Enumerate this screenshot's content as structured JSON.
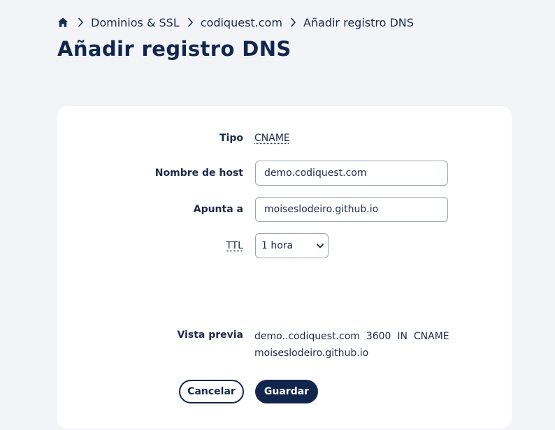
{
  "breadcrumb": {
    "home_icon": "home-icon",
    "separator_icon": "chevron-right-icon",
    "items": [
      "Dominios & SSL",
      "codiquest.com"
    ],
    "current": "Añadir registro DNS"
  },
  "page_title": "Añadir registro DNS",
  "form": {
    "type": {
      "label": "Tipo",
      "value": "CNAME"
    },
    "hostname": {
      "label": "Nombre de host",
      "value": "demo.codiquest.com"
    },
    "points_to": {
      "label": "Apunta a",
      "value": "moiseslodeiro.github.io"
    },
    "ttl": {
      "label": "TTL",
      "selected": "1 hora"
    },
    "preview": {
      "label": "Vista previa",
      "host": "demo..codiquest.com",
      "ttl": "3600",
      "class": "IN",
      "type": "CNAME",
      "target": "moiseslodeiro.github.io"
    },
    "cancel_label": "Cancelar",
    "save_label": "Guardar"
  },
  "colors": {
    "background": "#f2f4f8",
    "card": "#ffffff",
    "primary": "#12264d",
    "text": "#1b2a4a",
    "input_border": "#9aa4b4"
  }
}
